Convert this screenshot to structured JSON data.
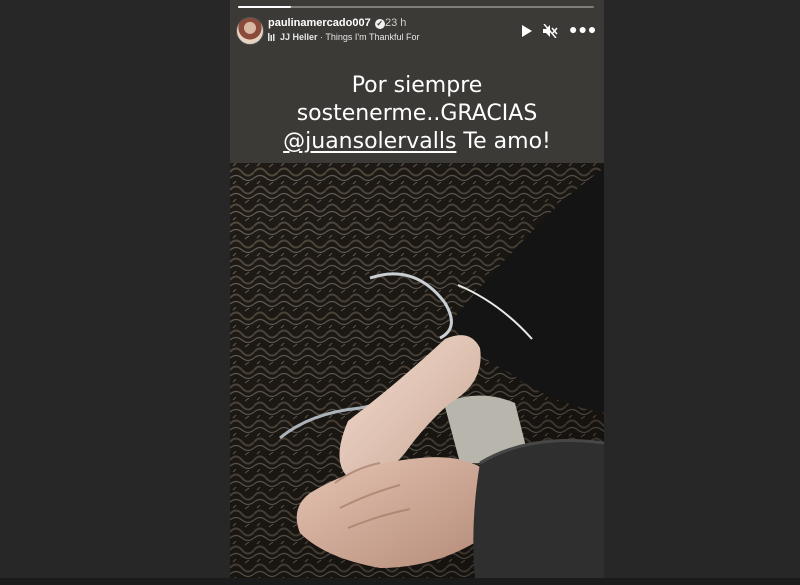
{
  "story": {
    "username": "paulinamercado007",
    "time_ago": "23 h",
    "music_artist": "JJ Heller",
    "music_separator": " · ",
    "music_title": "Things I'm Thankful For",
    "progress": 0.15,
    "caption_line1": "Por siempre",
    "caption_line2": "sostenerme..GRACIAS",
    "caption_mention": "@juansolervalls",
    "caption_tail": " Te amo!",
    "icons": [
      "play-icon",
      "mute-icon",
      "more-icon",
      "verified-icon",
      "music-icon"
    ]
  }
}
